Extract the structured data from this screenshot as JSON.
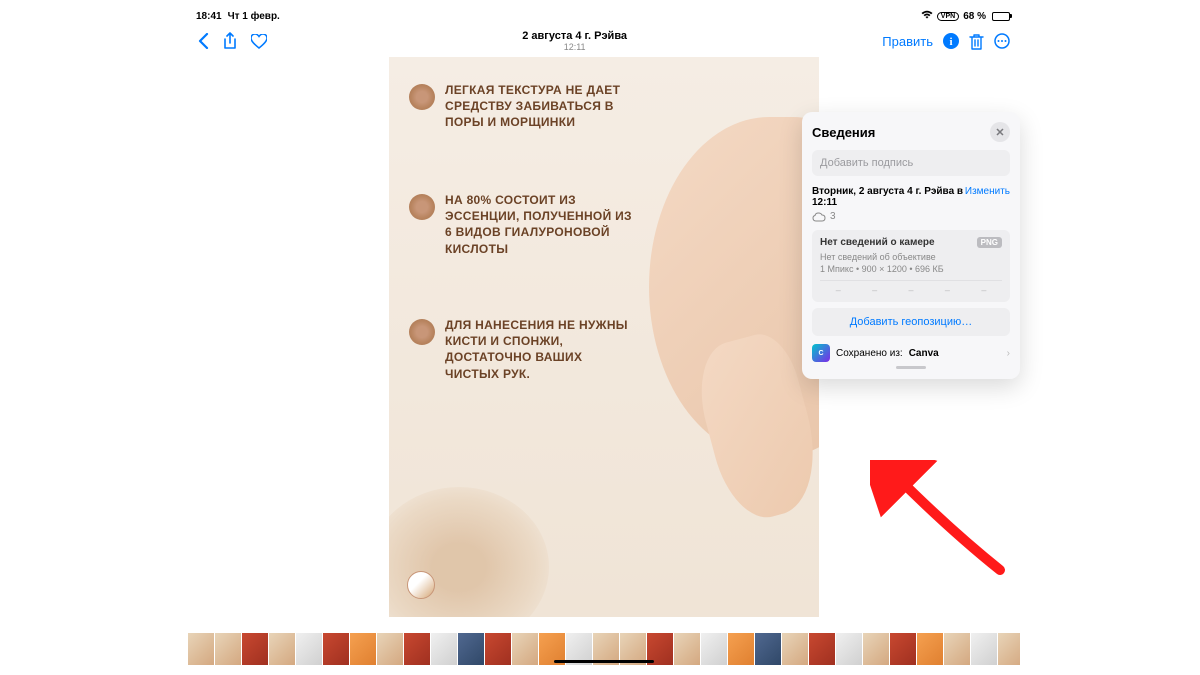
{
  "status": {
    "time": "18:41",
    "date": "Чт 1 февр.",
    "vpn": "VPN",
    "battery_pct": "68 %"
  },
  "toolbar": {
    "title": "2 августа 4 г. Рэйва",
    "subtitle": "12:11",
    "edit_label": "Править"
  },
  "photo": {
    "bullets": [
      "ЛЕГКАЯ ТЕКСТУРА НЕ ДАЕТ СРЕДСТВУ ЗАБИВАТЬСЯ В ПОРЫ И МОРЩИНКИ",
      "НА 80% СОСТОИТ ИЗ ЭССЕНЦИИ, ПОЛУЧЕННОЙ ИЗ 6 ВИДОВ ГИАЛУРОНОВОЙ КИСЛОТЫ",
      "ДЛЯ НАНЕСЕНИЯ НЕ НУЖНЫ КИСТИ И СПОНЖИ, ДОСТАТОЧНО ВАШИХ ЧИСТЫХ РУК."
    ]
  },
  "info": {
    "title": "Сведения",
    "caption_placeholder": "Добавить подпись",
    "date": "Вторник, 2 августа 4 г. Рэйва в 12:11",
    "modify": "Изменить",
    "cloud_count": "3",
    "camera_none": "Нет сведений о камере",
    "format_badge": "PNG",
    "lens_none": "Нет сведений об объективе",
    "meta": "1 Мпикс  •  900 × 1200  •  696 КБ",
    "exif": [
      "–",
      "–",
      "–",
      "–",
      "–"
    ],
    "add_geo": "Добавить геопозицию…",
    "saved_from": "Сохранено из:",
    "source_app": "Canva"
  }
}
